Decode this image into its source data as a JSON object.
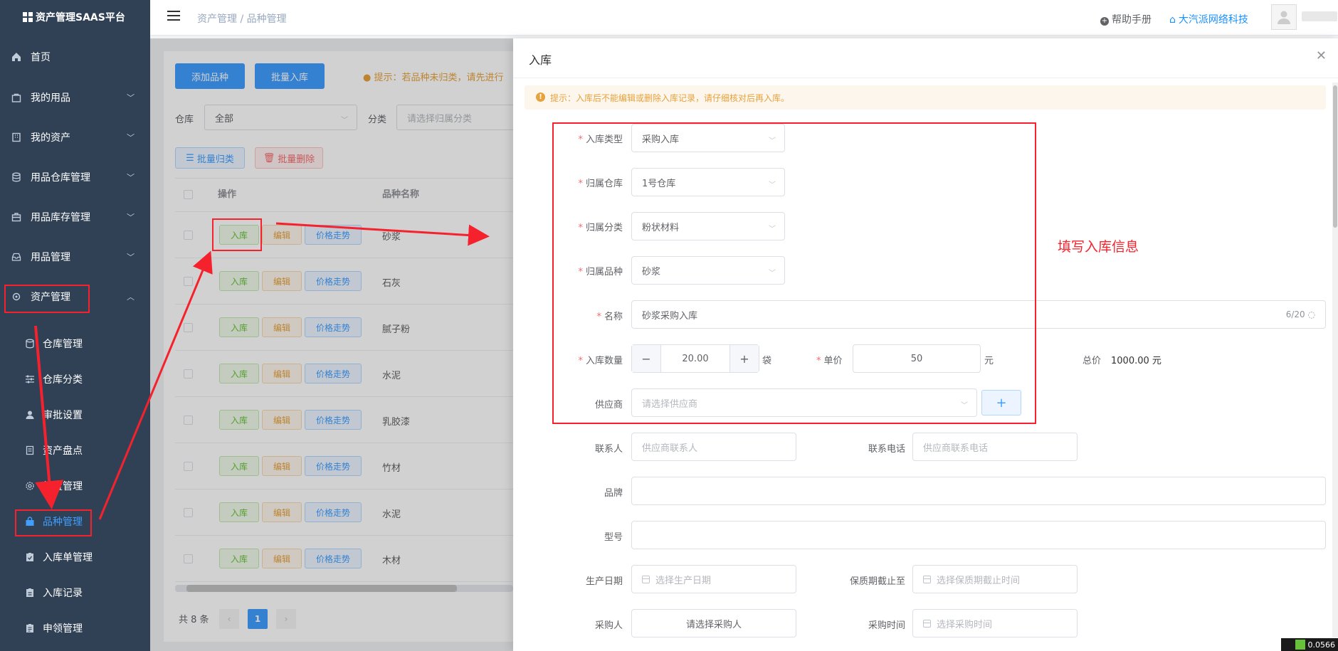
{
  "app_title": "资产管理SAAS平台",
  "sidebar": {
    "items": [
      {
        "label": "首页",
        "icon": "home-icon"
      },
      {
        "label": "我的用品",
        "icon": "bag-icon"
      },
      {
        "label": "我的资产",
        "icon": "building-icon"
      },
      {
        "label": "用品仓库管理",
        "icon": "database-icon"
      },
      {
        "label": "用品库存管理",
        "icon": "briefcase-icon"
      },
      {
        "label": "用品管理",
        "icon": "inbox-icon"
      },
      {
        "label": "资产管理",
        "icon": "gear-box-icon"
      }
    ],
    "subitems": [
      {
        "label": "仓库管理",
        "icon": "database-icon"
      },
      {
        "label": "仓库分类",
        "icon": "sliders-icon"
      },
      {
        "label": "审批设置",
        "icon": "user-icon"
      },
      {
        "label": "资产盘点",
        "icon": "document-icon"
      },
      {
        "label": "处置管理",
        "icon": "gear-icon"
      },
      {
        "label": "品种管理",
        "icon": "lock-bag-icon"
      },
      {
        "label": "入库单管理",
        "icon": "clipboard-check-icon"
      },
      {
        "label": "入库记录",
        "icon": "clipboard-icon"
      },
      {
        "label": "申领管理",
        "icon": "clipboard-list-icon"
      }
    ]
  },
  "header": {
    "breadcrumb": "资产管理 / 品种管理",
    "help": "帮助手册",
    "company": "大汽派网络科技"
  },
  "page": {
    "add_btn": "添加品种",
    "batch_in_btn": "批量入库",
    "tip": "提示：若品种未归类，请先进行",
    "warehouse_label": "仓库",
    "warehouse_value": "全部",
    "category_label": "分类",
    "category_placeholder": "请选择归属分类",
    "batch_classify": "批量归类",
    "batch_delete": "批量删除",
    "col_action": "操作",
    "col_name": "品种名称",
    "btn_in": "入库",
    "btn_edit": "编辑",
    "btn_price": "价格走势",
    "rows": [
      "砂浆",
      "石灰",
      "腻子粉",
      "水泥",
      "乳胶漆",
      "竹材",
      "水泥",
      "木材"
    ],
    "total": "共 8 条",
    "page_num": "1"
  },
  "drawer": {
    "title": "入库",
    "warning": "提示：入库后不能编辑或删除入库记录，请仔细核对后再入库。",
    "fields": {
      "type_label": "入库类型",
      "type_value": "采购入库",
      "warehouse_label": "归属仓库",
      "warehouse_value": "1号仓库",
      "category_label": "归属分类",
      "category_value": "粉状材料",
      "variety_label": "归属品种",
      "variety_value": "砂浆",
      "name_label": "名称",
      "name_value": "砂浆采购入库",
      "name_count": "6/20",
      "qty_label": "入库数量",
      "qty_value": "20.00",
      "qty_unit": "袋",
      "price_label": "单价",
      "price_value": "50",
      "price_unit": "元",
      "total_label": "总价",
      "total_value": "1000.00 元",
      "supplier_label": "供应商",
      "supplier_placeholder": "请选择供应商",
      "contact_label": "联系人",
      "contact_placeholder": "供应商联系人",
      "phone_label": "联系电话",
      "phone_placeholder": "供应商联系电话",
      "brand_label": "品牌",
      "model_label": "型号",
      "prod_date_label": "生产日期",
      "prod_date_placeholder": "选择生产日期",
      "expiry_label": "保质期截止至",
      "expiry_placeholder": "选择保质期截止时间",
      "buyer_label": "采购人",
      "buyer_btn": "请选择采购人",
      "buy_time_label": "采购时间",
      "buy_time_placeholder": "选择采购时间"
    }
  },
  "annotation": "填写入库信息",
  "corner_text": "0.0566",
  "colors": {
    "primary": "#409eff",
    "sidebar": "#304156",
    "annotation_red": "#f5222d"
  }
}
